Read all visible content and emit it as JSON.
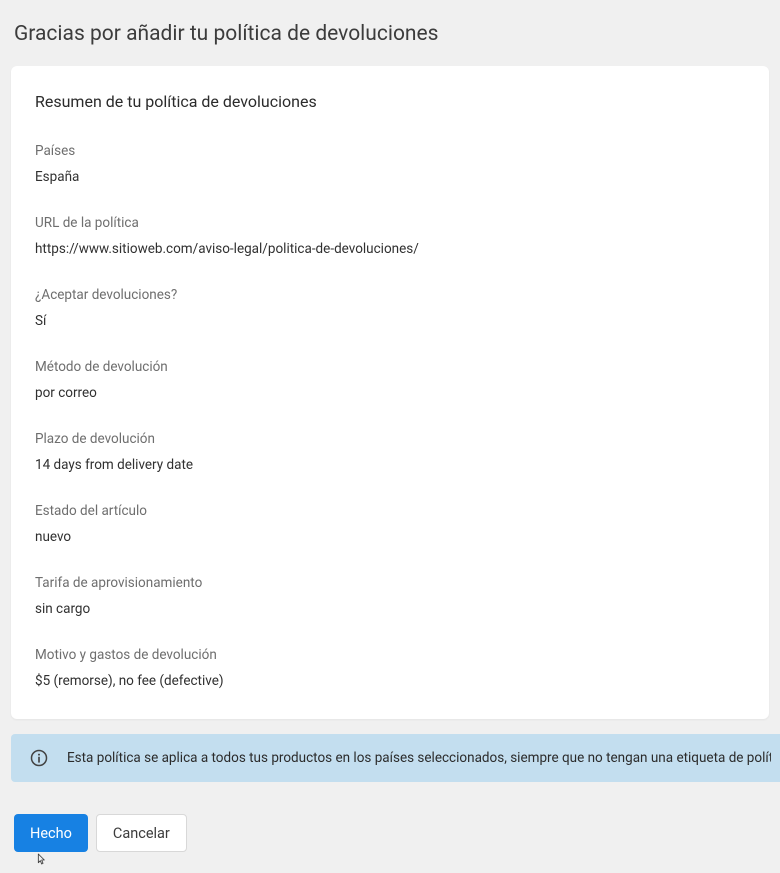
{
  "page": {
    "title": "Gracias por añadir tu política de devoluciones"
  },
  "card": {
    "title": "Resumen de tu política de devoluciones",
    "fields": {
      "countries": {
        "label": "Países",
        "value": "España"
      },
      "policy_url": {
        "label": "URL de la política",
        "value": "https://www.sitioweb.com/aviso-legal/politica-de-devoluciones/"
      },
      "accept_returns": {
        "label": "¿Aceptar devoluciones?",
        "value": "Sí"
      },
      "return_method": {
        "label": "Método de devolución",
        "value": "por correo"
      },
      "return_period": {
        "label": "Plazo de devolución",
        "value": "14 days from delivery date"
      },
      "article_state": {
        "label": "Estado del artículo",
        "value": "nuevo"
      },
      "provisioning_fee": {
        "label": "Tarifa de aprovisionamiento",
        "value": "sin cargo"
      },
      "reason_costs": {
        "label": "Motivo y gastos de devolución",
        "value": "$5 (remorse), no fee (defective)"
      }
    }
  },
  "info": {
    "text": "Esta política se aplica a todos tus productos en los países seleccionados, siempre que no tengan una etiqueta de política de devoluciones en los"
  },
  "buttons": {
    "done": "Hecho",
    "cancel": "Cancelar"
  }
}
